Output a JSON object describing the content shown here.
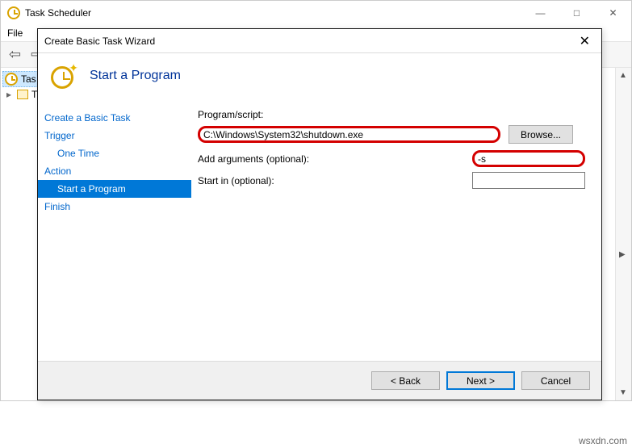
{
  "main": {
    "title": "Task Scheduler",
    "menu_file": "File",
    "tree_root": "Tas",
    "tree_child": "T"
  },
  "wizard": {
    "title": "Create Basic Task Wizard",
    "heading": "Start a Program",
    "nav": {
      "create": "Create a Basic Task",
      "trigger": "Trigger",
      "one_time": "One Time",
      "action": "Action",
      "start_program": "Start a Program",
      "finish": "Finish"
    },
    "form": {
      "program_label": "Program/script:",
      "program_value": "C:\\Windows\\System32\\shutdown.exe",
      "browse": "Browse...",
      "args_label": "Add arguments (optional):",
      "args_value": "-s",
      "startin_label": "Start in (optional):",
      "startin_value": ""
    },
    "footer": {
      "back": "< Back",
      "next": "Next >",
      "cancel": "Cancel"
    }
  },
  "watermark": "wsxdn.com"
}
